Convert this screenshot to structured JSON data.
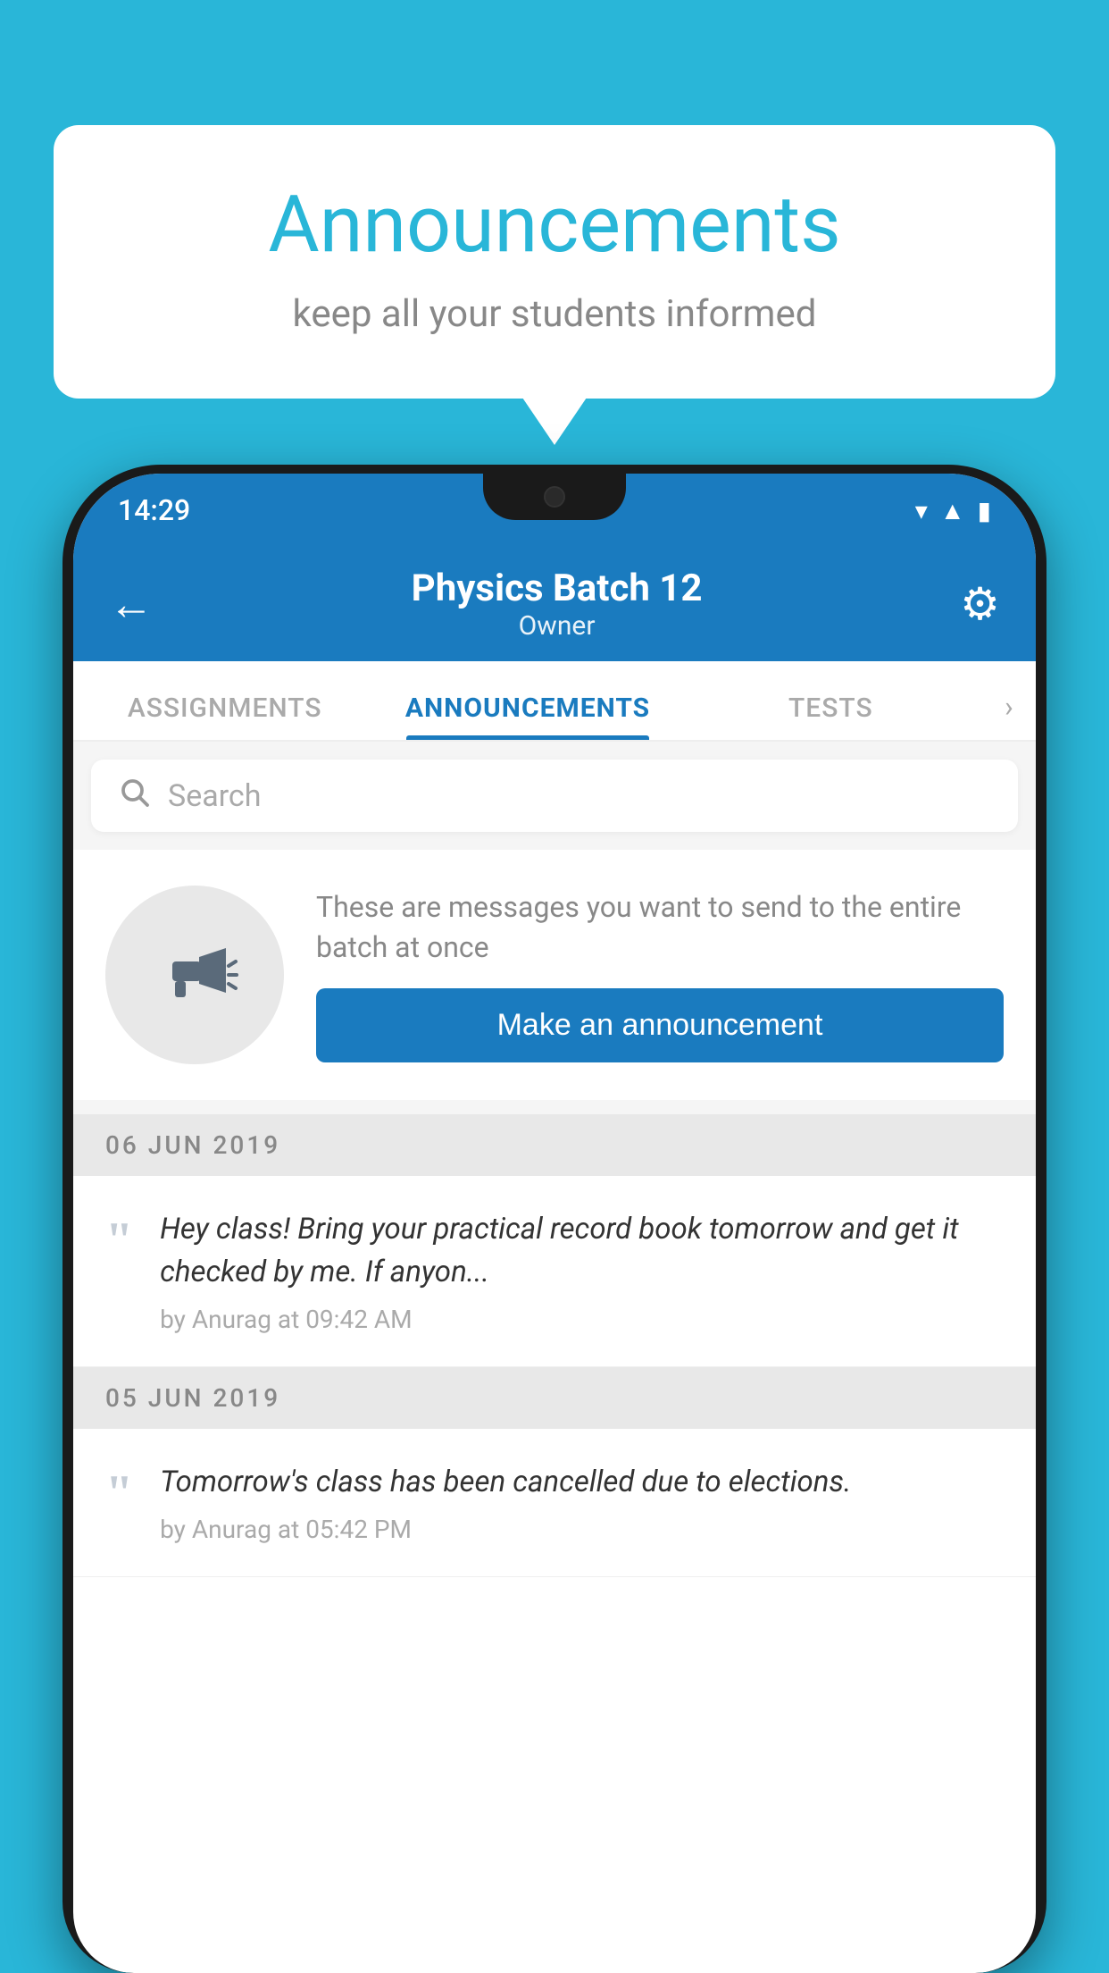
{
  "background_color": "#29b6d8",
  "speech_bubble": {
    "title": "Announcements",
    "subtitle": "keep all your students informed"
  },
  "status_bar": {
    "time": "14:29",
    "wifi": "▼",
    "signal": "▲",
    "battery": "▮"
  },
  "app_header": {
    "title": "Physics Batch 12",
    "subtitle": "Owner",
    "back_label": "←",
    "gear_label": "⚙"
  },
  "tabs": [
    {
      "label": "ASSIGNMENTS",
      "active": false
    },
    {
      "label": "ANNOUNCEMENTS",
      "active": true
    },
    {
      "label": "TESTS",
      "active": false
    }
  ],
  "search": {
    "placeholder": "Search"
  },
  "promo": {
    "description": "These are messages you want to send to the entire batch at once",
    "button_label": "Make an announcement"
  },
  "date_groups": [
    {
      "date": "06  JUN  2019",
      "announcements": [
        {
          "text": "Hey class! Bring your practical record book tomorrow and get it checked by me. If anyon...",
          "meta": "by Anurag at 09:42 AM"
        }
      ]
    },
    {
      "date": "05  JUN  2019",
      "announcements": [
        {
          "text": "Tomorrow's class has been cancelled due to elections.",
          "meta": "by Anurag at 05:42 PM"
        }
      ]
    }
  ]
}
